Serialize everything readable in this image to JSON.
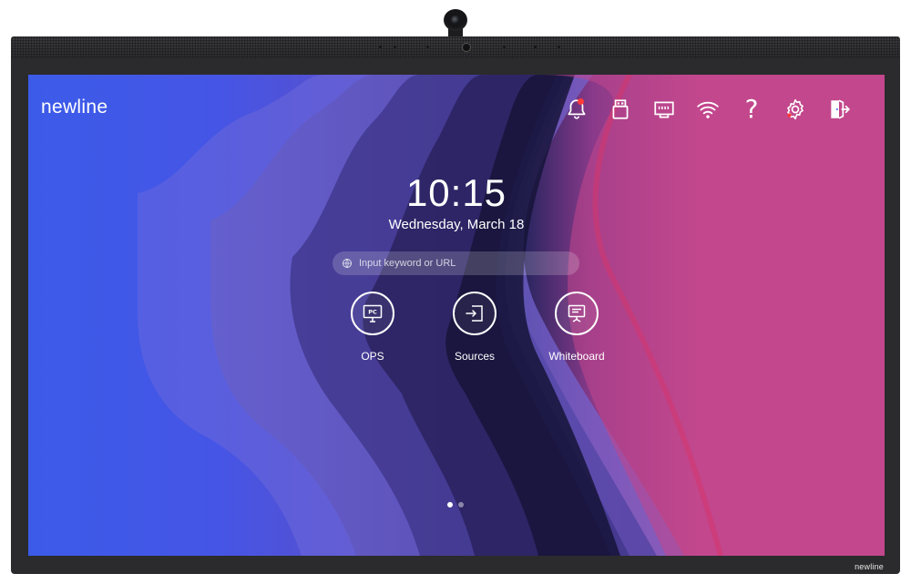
{
  "brand": "newline",
  "bezel_brand": "newline",
  "clock": {
    "time": "10:15",
    "date": "Wednesday, March 18"
  },
  "search": {
    "placeholder": "Input keyword or URL"
  },
  "toolbar": [
    {
      "icon": "bell-icon",
      "has_notification": true
    },
    {
      "icon": "usb-icon"
    },
    {
      "icon": "ethernet-icon"
    },
    {
      "icon": "wifi-icon"
    },
    {
      "icon": "help-icon",
      "glyph": "?"
    },
    {
      "icon": "settings-icon"
    },
    {
      "icon": "exit-icon"
    }
  ],
  "apps": [
    {
      "label": "OPS",
      "icon": "pc-monitor-icon",
      "icon_text": "PC"
    },
    {
      "label": "Sources",
      "icon": "input-source-icon"
    },
    {
      "label": "Whiteboard",
      "icon": "whiteboard-icon"
    }
  ],
  "pager": {
    "count": 2,
    "active": 0
  },
  "colors": {
    "accent_left": "#3c5be8",
    "accent_right": "#c24a8c",
    "notification": "#ff3b3b",
    "bezel": "#2b2b2d"
  }
}
